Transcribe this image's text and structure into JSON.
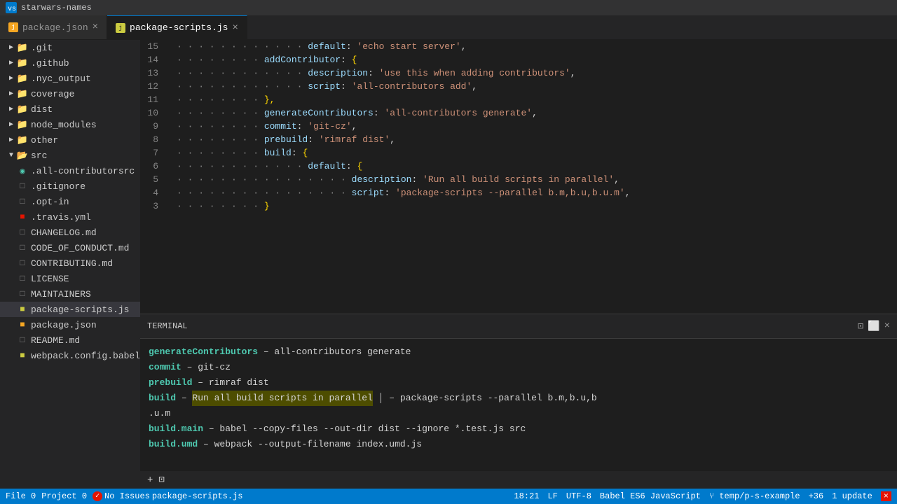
{
  "titleBar": {
    "icon": "vscode-icon",
    "title": "starwars-names"
  },
  "tabs": [
    {
      "id": "package-json",
      "label": "package.json",
      "type": "json",
      "active": false
    },
    {
      "id": "package-scripts-js",
      "label": "package-scripts.js",
      "type": "js",
      "active": true
    }
  ],
  "sidebar": {
    "projectName": "starwars-names",
    "items": [
      {
        "id": "git",
        "label": ".git",
        "type": "folder",
        "indent": 1,
        "collapsed": true
      },
      {
        "id": "github",
        "label": ".github",
        "type": "folder",
        "indent": 1,
        "collapsed": true
      },
      {
        "id": "nyc_output",
        "label": ".nyc_output",
        "type": "folder",
        "indent": 1,
        "collapsed": true
      },
      {
        "id": "coverage",
        "label": "coverage",
        "type": "folder",
        "indent": 1,
        "collapsed": true
      },
      {
        "id": "dist",
        "label": "dist",
        "type": "folder",
        "indent": 1,
        "collapsed": true
      },
      {
        "id": "node_modules",
        "label": "node_modules",
        "type": "folder",
        "indent": 1,
        "collapsed": true
      },
      {
        "id": "other",
        "label": "other",
        "type": "folder",
        "indent": 1,
        "collapsed": true
      },
      {
        "id": "src",
        "label": "src",
        "type": "folder",
        "indent": 1,
        "collapsed": true
      },
      {
        "id": "all-contributorsrc",
        "label": ".all-contributorsrc",
        "type": "file-special",
        "indent": 2
      },
      {
        "id": "gitignore",
        "label": ".gitignore",
        "type": "file-plain",
        "indent": 2
      },
      {
        "id": "opt-in",
        "label": ".opt-in",
        "type": "file-plain",
        "indent": 2
      },
      {
        "id": "travis-yml",
        "label": ".travis.yml",
        "type": "file-red",
        "indent": 2
      },
      {
        "id": "changelog",
        "label": "CHANGELOG.md",
        "type": "file-plain",
        "indent": 2
      },
      {
        "id": "code-of-conduct",
        "label": "CODE_OF_CONDUCT.md",
        "type": "file-plain",
        "indent": 2
      },
      {
        "id": "contributing",
        "label": "CONTRIBUTING.md",
        "type": "file-plain",
        "indent": 2
      },
      {
        "id": "license",
        "label": "LICENSE",
        "type": "file-plain",
        "indent": 2
      },
      {
        "id": "maintainers",
        "label": "MAINTAINERS",
        "type": "file-plain",
        "indent": 2
      },
      {
        "id": "package-scripts-file",
        "label": "package-scripts.js",
        "type": "file-js",
        "indent": 2
      },
      {
        "id": "package-json-file",
        "label": "package.json",
        "type": "file-json",
        "indent": 2
      },
      {
        "id": "readme",
        "label": "README.md",
        "type": "file-plain",
        "indent": 2
      },
      {
        "id": "webpack-config",
        "label": "webpack.config.babel.js",
        "type": "file-js",
        "indent": 2
      }
    ]
  },
  "codeLines": [
    {
      "num": "15",
      "content": "            default: 'echo start server',"
    },
    {
      "num": "14",
      "content": "        addContributor: {"
    },
    {
      "num": "13",
      "content": "            description: 'use this when adding contributors',"
    },
    {
      "num": "12",
      "content": "            script: 'all-contributors add',"
    },
    {
      "num": "11",
      "content": "        },"
    },
    {
      "num": "10",
      "content": "        generateContributors: 'all-contributors generate',"
    },
    {
      "num": "9",
      "content": "        commit: 'git-cz',"
    },
    {
      "num": "8",
      "content": "        prebuild: 'rimraf dist',"
    },
    {
      "num": "7",
      "content": "        build: {"
    },
    {
      "num": "6",
      "content": "            default: {"
    },
    {
      "num": "5",
      "content": "                description: 'Run all build scripts in parallel',"
    },
    {
      "num": "4",
      "content": "                script: 'package-scripts --parallel b.m,b.u,b.u.m',"
    },
    {
      "num": "3",
      "content": "        }"
    }
  ],
  "terminal": {
    "lines": [
      {
        "id": "t1",
        "label": "generateContributors",
        "separator": " – ",
        "value": "all-contributors generate"
      },
      {
        "id": "t2",
        "label": "commit",
        "separator": " – ",
        "value": "git-cz"
      },
      {
        "id": "t3",
        "label": "prebuild",
        "separator": " – ",
        "value": "rimraf dist"
      },
      {
        "id": "t4",
        "label": "build",
        "separator": " – ",
        "highlight": "Run all build scripts in parallel",
        "separator2": " – ",
        "value": "package-scripts --parallel b.m,b.u,b"
      },
      {
        "id": "t4b",
        "label": "",
        "value": ".u.m"
      },
      {
        "id": "t5",
        "label": "build.main",
        "separator": " – ",
        "value": "babel --copy-files --out-dir dist --ignore *.test.js src"
      },
      {
        "id": "t6",
        "label": "build.umd",
        "separator": " – ",
        "value": "webpack --output-filename index.umd.js"
      }
    ],
    "controls": [
      "split-terminal-icon",
      "maximize-icon",
      "close-icon"
    ]
  },
  "statusBar": {
    "fileItem": "File 0",
    "projectItem": "Project 0",
    "noIssues": "No Issues",
    "filename": "package-scripts.js",
    "position": "18:21",
    "eol": "LF",
    "encoding": "UTF-8",
    "language": "Babel ES6 JavaScript",
    "gitBranch": "temp/p-s-example",
    "notifications": "+36",
    "updateBadge": "1 update",
    "errorIcon": "×"
  }
}
